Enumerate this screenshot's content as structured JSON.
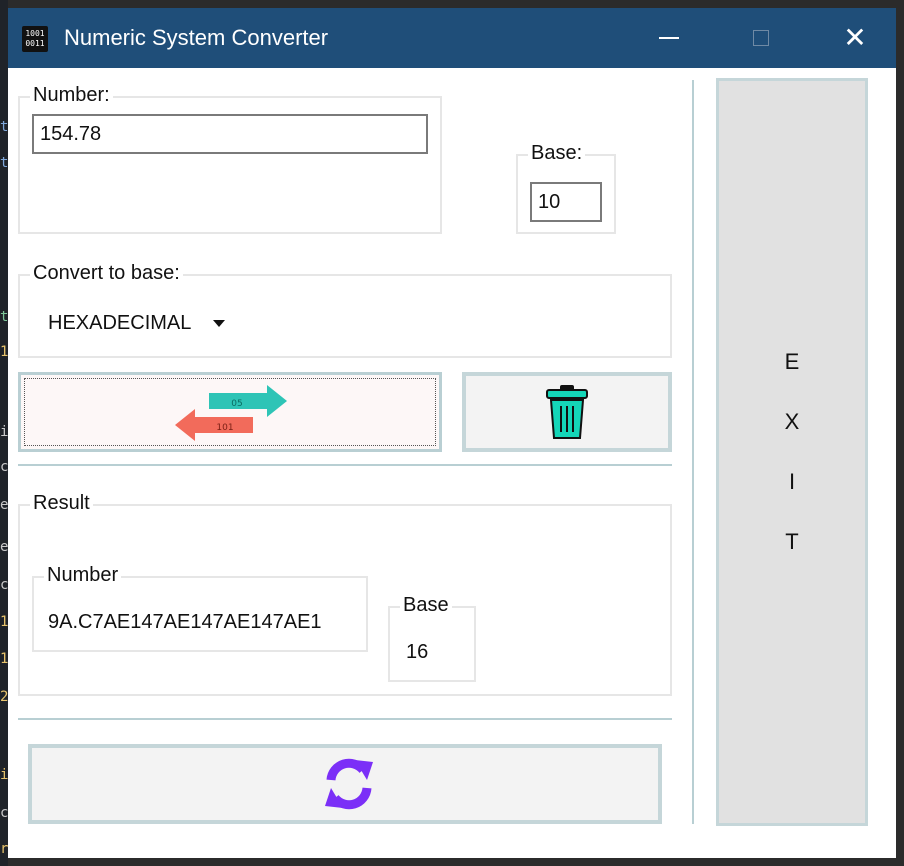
{
  "window": {
    "title": "Numeric System Converter",
    "icon_text": [
      "1001",
      "0011"
    ]
  },
  "input_group": {
    "label": "Number:",
    "value": "154.78"
  },
  "base_group": {
    "label": "Base:",
    "value": "10"
  },
  "convert_group": {
    "label": "Convert to base:",
    "selected": "HEXADECIMAL"
  },
  "convert_button": {
    "arrow_top_text": "05",
    "arrow_bottom_text": "101"
  },
  "result_group": {
    "label": "Result",
    "number_label": "Number",
    "number_value": "9A.C7AE147AE147AE147AE1",
    "base_label": "Base",
    "base_value": "16"
  },
  "exit_button": {
    "letters": [
      "E",
      "X",
      "I",
      "T"
    ]
  },
  "colors": {
    "titlebar": "#1f4e79",
    "trash": "#14d6b8",
    "refresh": "#7b2ff7",
    "arrow_teal": "#2ec4b6",
    "arrow_red": "#f26b5b"
  },
  "icons": {
    "convert": "swap-arrows-icon",
    "clear": "trash-icon",
    "reset": "refresh-icon"
  }
}
